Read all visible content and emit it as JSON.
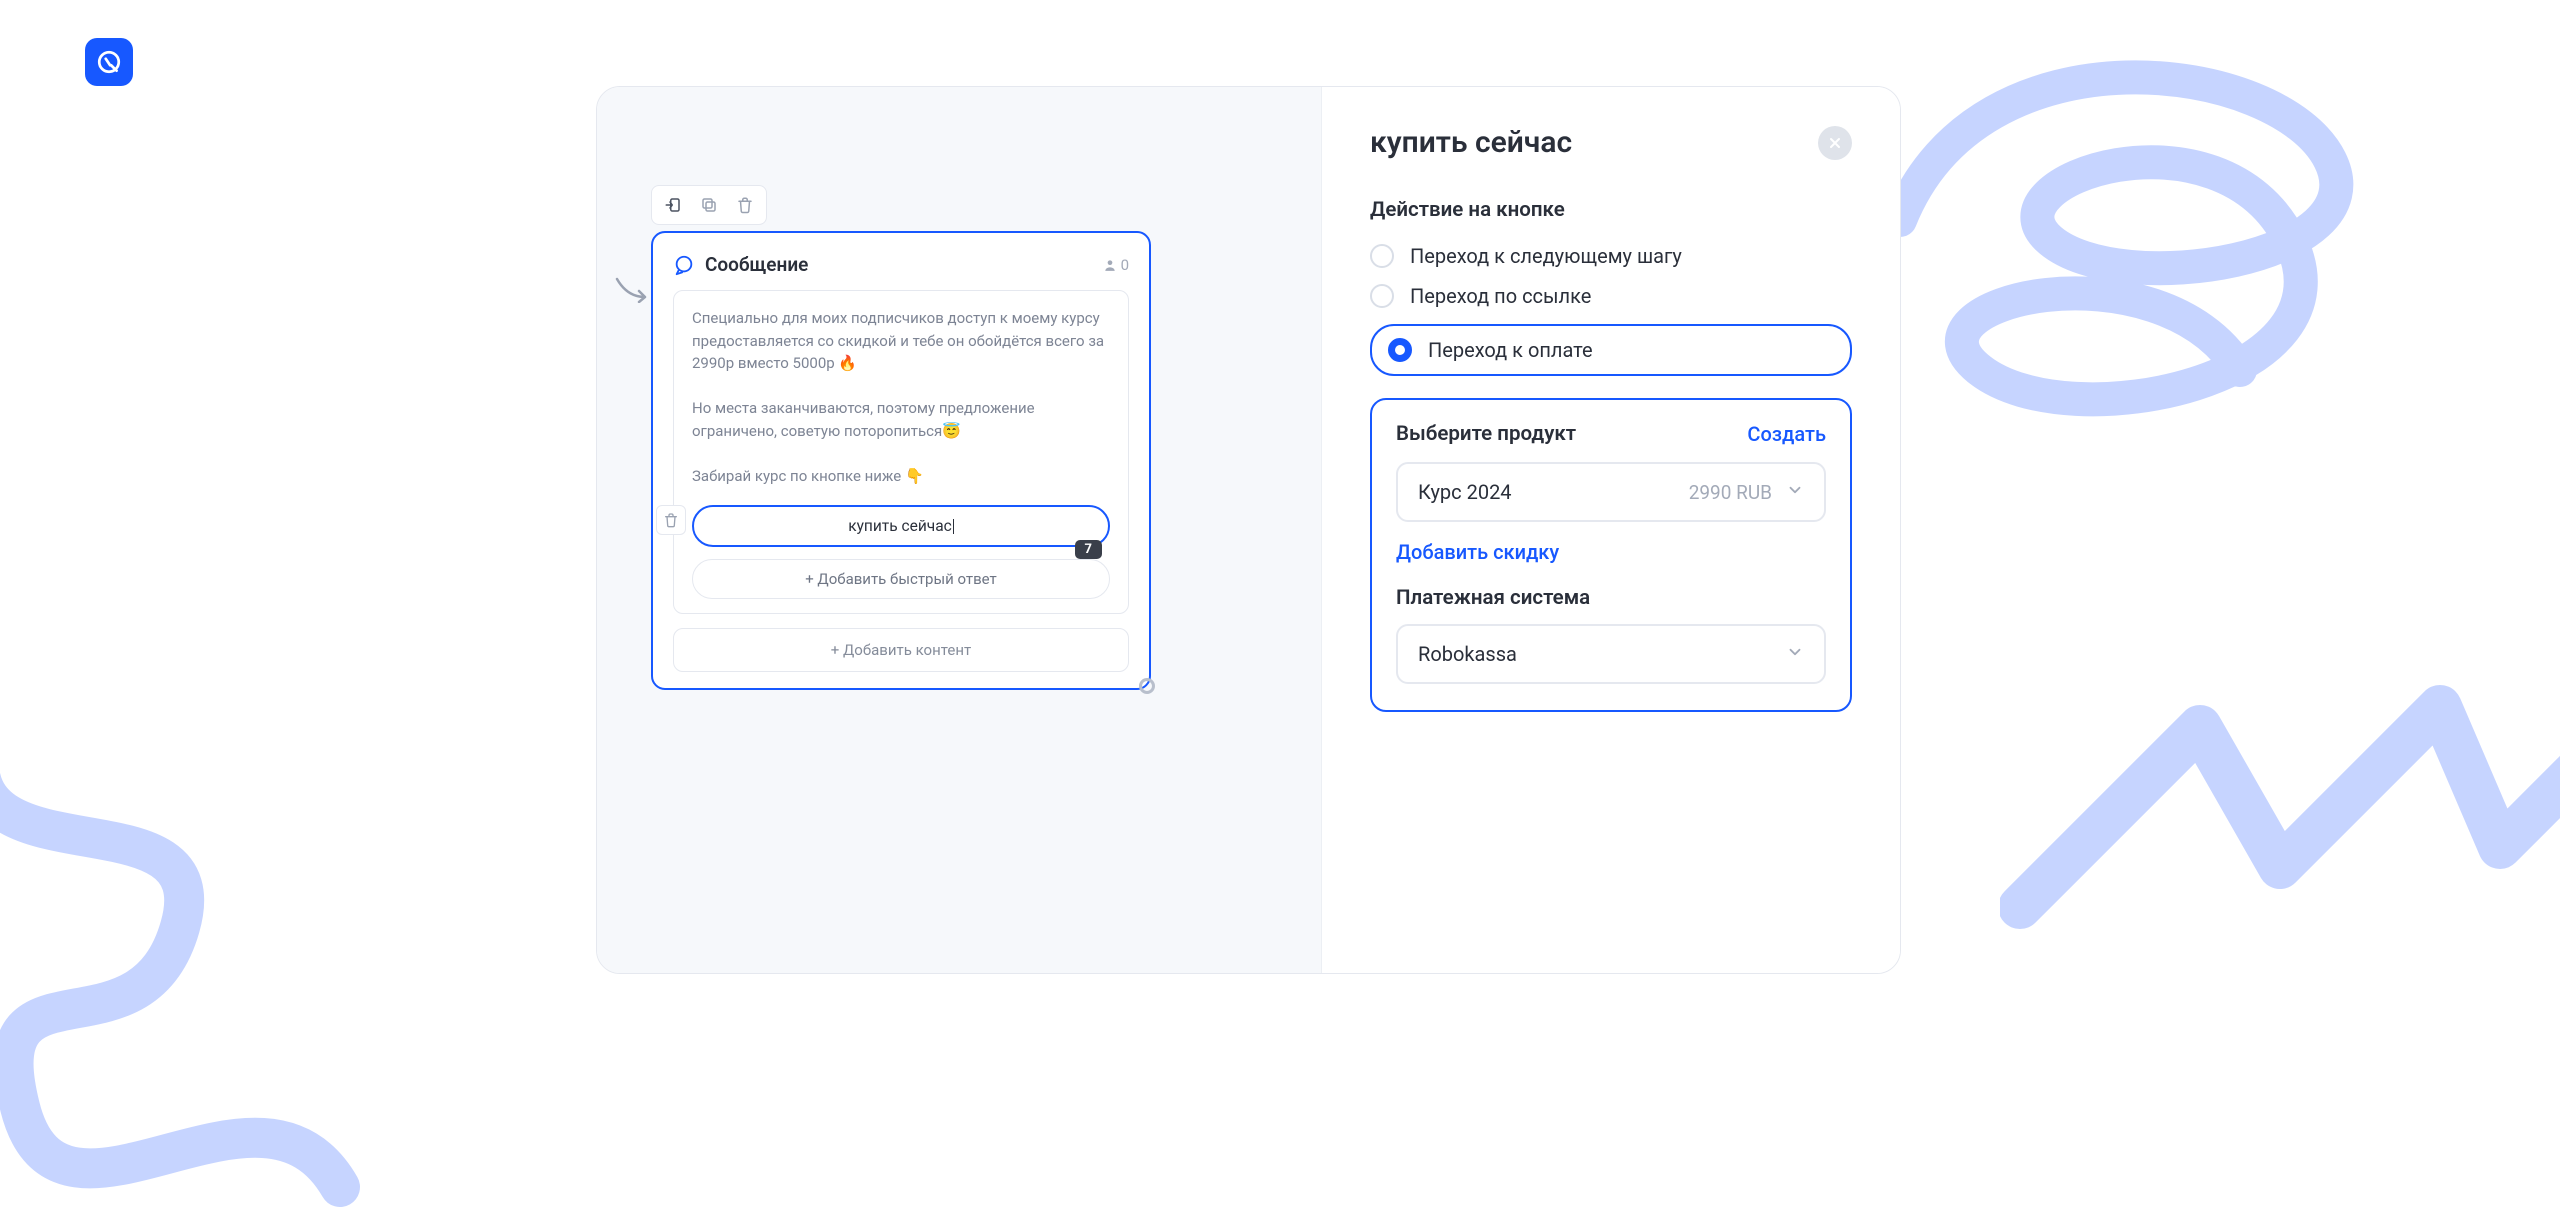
{
  "logo": {
    "name": "app-logo"
  },
  "card": {
    "title": "Сообщение",
    "user_count": "0",
    "body_text": "Специально для моих подписчиков доступ к моему курсу предоставляется со скидкой и тебе он обойдётся всего за 2990р вместо 5000р 🔥\n\nНо места заканчиваются, поэтому предложение ограничено, советую поторопиться😇\n\nЗабирай курс по кнопке ниже 👇",
    "buy_button_label": "купить сейчас",
    "counter_badge": "7",
    "add_quick_reply": "+ Добавить быстрый ответ",
    "add_content": "+ Добавить контент"
  },
  "panel": {
    "title": "купить сейчас",
    "action_section_title": "Действие на кнопке",
    "actions": [
      {
        "label": "Переход к следующему шагу",
        "selected": false
      },
      {
        "label": "Переход по ссылке",
        "selected": false
      },
      {
        "label": "Переход к оплате",
        "selected": true
      }
    ],
    "product": {
      "section_title": "Выберите продукт",
      "create_link": "Создать",
      "selected_name": "Курс 2024",
      "selected_price": "2990 RUB",
      "discount_link": "Добавить скидку",
      "payment_system_title": "Платежная система",
      "payment_system_value": "Robokassa"
    }
  },
  "icons": {
    "toolbar": [
      "enter-icon",
      "copy-icon",
      "trash-icon"
    ]
  }
}
